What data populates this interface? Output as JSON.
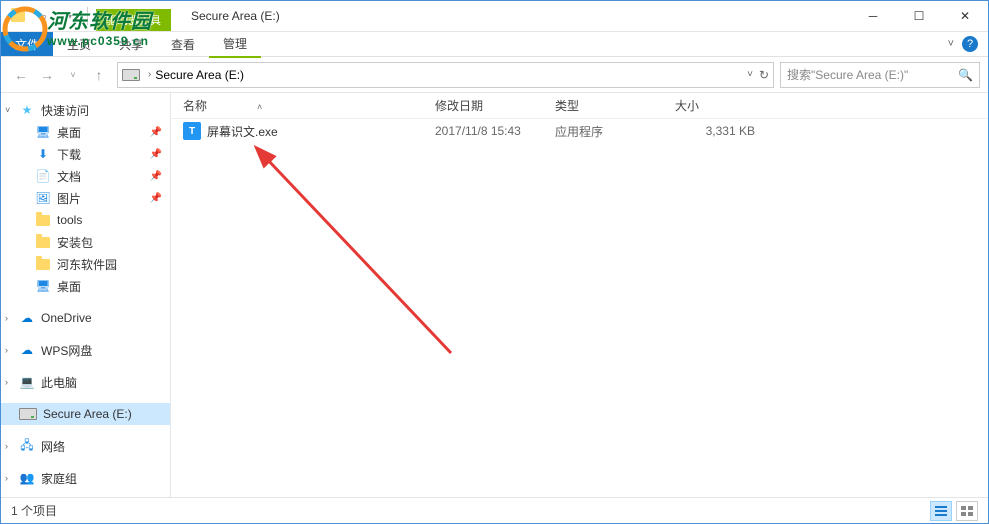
{
  "window": {
    "title": "Secure Area (E:)",
    "contextual_tab_label": "驱动器工具",
    "contextual_tab_name": "管理"
  },
  "ribbon": {
    "file": "文件",
    "tabs": [
      "主页",
      "共享",
      "查看"
    ]
  },
  "navbar": {
    "path_segments": [
      "Secure Area (E:)"
    ],
    "search_placeholder": "搜索\"Secure Area (E:)\""
  },
  "sidebar": {
    "quick_access": "快速访问",
    "pinned": [
      {
        "label": "桌面",
        "type": "desktop"
      },
      {
        "label": "下载",
        "type": "downloads"
      },
      {
        "label": "文档",
        "type": "documents"
      },
      {
        "label": "图片",
        "type": "pictures"
      },
      {
        "label": "tools",
        "type": "folder"
      },
      {
        "label": "安装包",
        "type": "folder"
      },
      {
        "label": "河东软件园",
        "type": "folder"
      },
      {
        "label": "桌面",
        "type": "desktop2"
      }
    ],
    "groups": [
      {
        "label": "OneDrive",
        "icon": "onedrive"
      },
      {
        "label": "WPS网盘",
        "icon": "wps"
      },
      {
        "label": "此电脑",
        "icon": "thispc"
      },
      {
        "label": "Secure Area (E:)",
        "icon": "drive",
        "selected": true
      },
      {
        "label": "网络",
        "icon": "network"
      },
      {
        "label": "家庭组",
        "icon": "homegroup"
      }
    ]
  },
  "columns": {
    "name": "名称",
    "date": "修改日期",
    "type": "类型",
    "size": "大小"
  },
  "files": [
    {
      "name": "屏幕识文.exe",
      "date": "2017/11/8 15:43",
      "type": "应用程序",
      "size": "3,331 KB",
      "icon_letter": "T"
    }
  ],
  "statusbar": {
    "item_count": "1 个项目"
  },
  "watermark": {
    "text": "河东软件园",
    "url": "www.pc0359.cn"
  }
}
